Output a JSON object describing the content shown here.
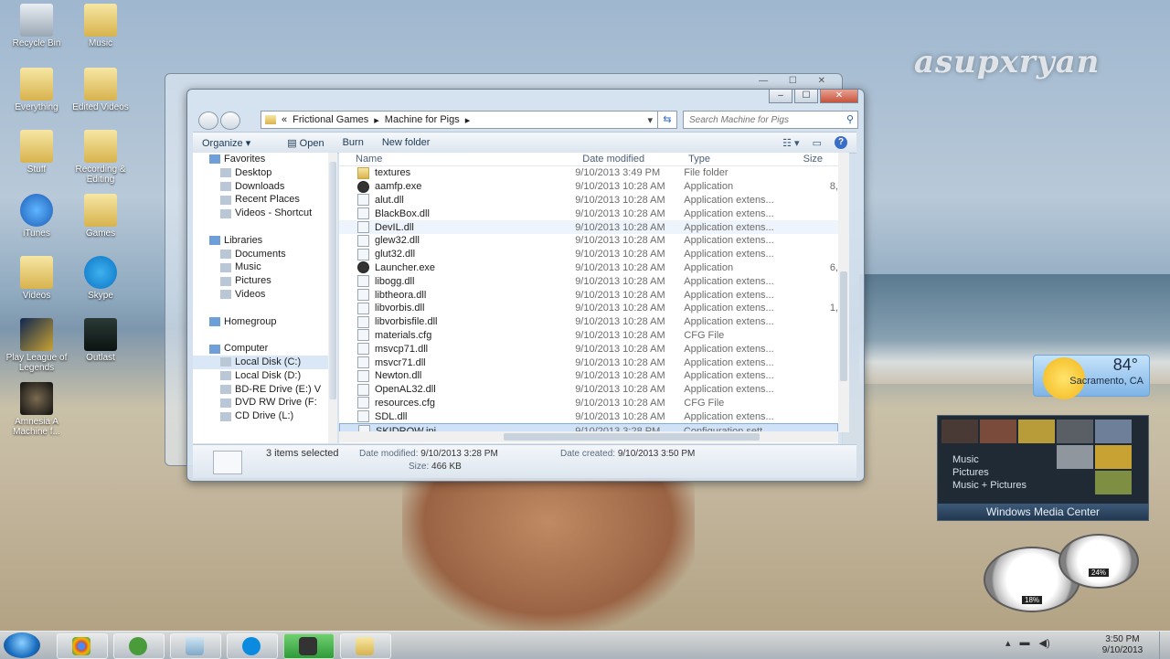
{
  "desktop": {
    "watermark": "asupxryan",
    "icons": [
      {
        "label": "Recycle Bin",
        "kind": "bin"
      },
      {
        "label": "Music",
        "kind": "folder"
      },
      {
        "label": "Everything",
        "kind": "folder"
      },
      {
        "label": "Edited Videos",
        "kind": "folder"
      },
      {
        "label": "Stuff",
        "kind": "folder"
      },
      {
        "label": "Recording & Editing",
        "kind": "folder"
      },
      {
        "label": "iTunes",
        "kind": "itunes"
      },
      {
        "label": "Games",
        "kind": "folder"
      },
      {
        "label": "Videos",
        "kind": "folder"
      },
      {
        "label": "Skype",
        "kind": "skype"
      },
      {
        "label": "Play League of Legends",
        "kind": "lol"
      },
      {
        "label": "Outlast",
        "kind": "outlast"
      },
      {
        "label": "Amnesia A Machine f...",
        "kind": "amnesia"
      }
    ]
  },
  "explorer": {
    "breadcrumb": [
      "«",
      "Frictional Games",
      "Machine for Pigs"
    ],
    "search_placeholder": "Search Machine for Pigs",
    "toolbar": {
      "organize": "Organize",
      "open": "Open",
      "burn": "Burn",
      "new_folder": "New folder"
    },
    "nav": [
      {
        "label": "Favorites",
        "group": true
      },
      {
        "label": "Desktop"
      },
      {
        "label": "Downloads"
      },
      {
        "label": "Recent Places"
      },
      {
        "label": "Videos - Shortcut"
      },
      {
        "label": "",
        "spacer": true
      },
      {
        "label": "Libraries",
        "group": true
      },
      {
        "label": "Documents"
      },
      {
        "label": "Music"
      },
      {
        "label": "Pictures"
      },
      {
        "label": "Videos"
      },
      {
        "label": "",
        "spacer": true
      },
      {
        "label": "Homegroup",
        "group": true
      },
      {
        "label": "",
        "spacer": true
      },
      {
        "label": "Computer",
        "group": true
      },
      {
        "label": "Local Disk (C:)",
        "selected": true
      },
      {
        "label": "Local Disk (D:)"
      },
      {
        "label": "BD-RE Drive (E:) V"
      },
      {
        "label": "DVD RW Drive (F:"
      },
      {
        "label": "CD Drive (L:)"
      }
    ],
    "columns": {
      "name": "Name",
      "date": "Date modified",
      "type": "Type",
      "size": "Size"
    },
    "files": [
      {
        "name": "textures",
        "date": "9/10/2013 3:49 PM",
        "type": "File folder",
        "size": "",
        "icon": "folder"
      },
      {
        "name": "aamfp.exe",
        "date": "9/10/2013 10:28 AM",
        "type": "Application",
        "size": "8,",
        "icon": "app"
      },
      {
        "name": "alut.dll",
        "date": "9/10/2013 10:28 AM",
        "type": "Application extens...",
        "size": "",
        "icon": "dll"
      },
      {
        "name": "BlackBox.dll",
        "date": "9/10/2013 10:28 AM",
        "type": "Application extens...",
        "size": "",
        "icon": "dll"
      },
      {
        "name": "DevIL.dll",
        "date": "9/10/2013 10:28 AM",
        "type": "Application extens...",
        "size": "",
        "icon": "dll",
        "hover": true
      },
      {
        "name": "glew32.dll",
        "date": "9/10/2013 10:28 AM",
        "type": "Application extens...",
        "size": "",
        "icon": "dll"
      },
      {
        "name": "glut32.dll",
        "date": "9/10/2013 10:28 AM",
        "type": "Application extens...",
        "size": "",
        "icon": "dll"
      },
      {
        "name": "Launcher.exe",
        "date": "9/10/2013 10:28 AM",
        "type": "Application",
        "size": "6,",
        "icon": "app"
      },
      {
        "name": "libogg.dll",
        "date": "9/10/2013 10:28 AM",
        "type": "Application extens...",
        "size": "",
        "icon": "dll"
      },
      {
        "name": "libtheora.dll",
        "date": "9/10/2013 10:28 AM",
        "type": "Application extens...",
        "size": "",
        "icon": "dll"
      },
      {
        "name": "libvorbis.dll",
        "date": "9/10/2013 10:28 AM",
        "type": "Application extens...",
        "size": "1,",
        "icon": "dll"
      },
      {
        "name": "libvorbisfile.dll",
        "date": "9/10/2013 10:28 AM",
        "type": "Application extens...",
        "size": "",
        "icon": "dll"
      },
      {
        "name": "materials.cfg",
        "date": "9/10/2013 10:28 AM",
        "type": "CFG File",
        "size": "",
        "icon": "doc"
      },
      {
        "name": "msvcp71.dll",
        "date": "9/10/2013 10:28 AM",
        "type": "Application extens...",
        "size": "",
        "icon": "dll"
      },
      {
        "name": "msvcr71.dll",
        "date": "9/10/2013 10:28 AM",
        "type": "Application extens...",
        "size": "",
        "icon": "dll"
      },
      {
        "name": "Newton.dll",
        "date": "9/10/2013 10:28 AM",
        "type": "Application extens...",
        "size": "",
        "icon": "dll"
      },
      {
        "name": "OpenAL32.dll",
        "date": "9/10/2013 10:28 AM",
        "type": "Application extens...",
        "size": "",
        "icon": "dll"
      },
      {
        "name": "resources.cfg",
        "date": "9/10/2013 10:28 AM",
        "type": "CFG File",
        "size": "",
        "icon": "doc"
      },
      {
        "name": "SDL.dll",
        "date": "9/10/2013 10:28 AM",
        "type": "Application extens...",
        "size": "",
        "icon": "dll"
      },
      {
        "name": "SKIDROW.ini",
        "date": "9/10/2013 3:28 PM",
        "type": "Configuration sett...",
        "size": "",
        "icon": "doc",
        "selected": true
      }
    ],
    "details": {
      "selection": "3 items selected",
      "modified_label": "Date modified:",
      "modified": "9/10/2013 3:28 PM",
      "created_label": "Date created:",
      "created": "9/10/2013 3:50 PM",
      "size_label": "Size:",
      "size": "466 KB"
    }
  },
  "gadgets": {
    "weather": {
      "temp": "84°",
      "city": "Sacramento, CA"
    },
    "media_center": {
      "items": [
        "Music",
        "Pictures",
        "Music + Pictures"
      ],
      "title": "Windows Media Center"
    },
    "cpu_percent": "18%",
    "mem_percent": "24%"
  },
  "taskbar": {
    "apps": [
      "chrome",
      "utorrent",
      "explorer-gadget",
      "skype",
      "game",
      "explorer"
    ],
    "time": "3:50 PM",
    "date": "9/10/2013"
  }
}
